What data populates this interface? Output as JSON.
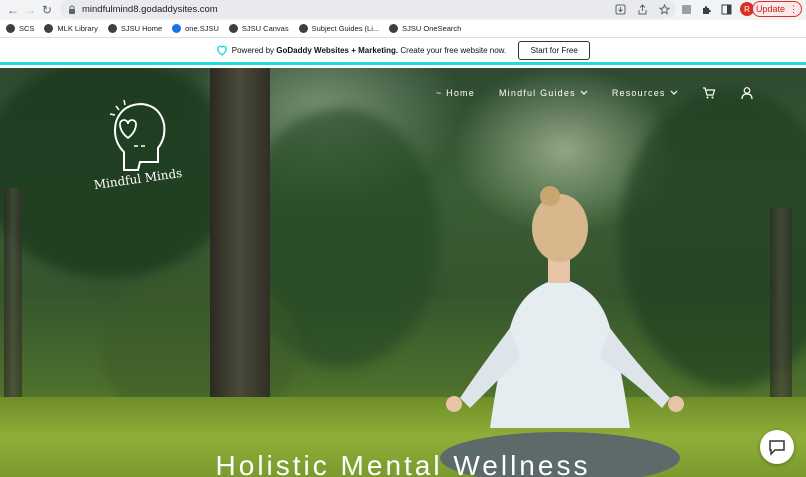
{
  "browser": {
    "url": "mindfulmind8.godaddysites.com",
    "update_label": "Update",
    "profile_initial": "R",
    "bookmarks": [
      {
        "label": "SCS"
      },
      {
        "label": "MLK Library"
      },
      {
        "label": "SJSU Home"
      },
      {
        "label": "one.SJSU"
      },
      {
        "label": "SJSU Canvas"
      },
      {
        "label": "Subject Guides (Li..."
      },
      {
        "label": "SJSU OneSearch"
      }
    ]
  },
  "banner": {
    "prefix": "Powered by",
    "brand": "GoDaddy Websites + Marketing.",
    "suffix": "Create your free website now.",
    "cta": "Start for Free",
    "accent": "#1bdbdb"
  },
  "site": {
    "logo_text": "Mindful Minds",
    "nav": [
      {
        "label": "~ Home"
      },
      {
        "label": "Mindful Guides"
      },
      {
        "label": "Resources"
      }
    ],
    "hero_title": "Holistic Mental Wellness"
  }
}
